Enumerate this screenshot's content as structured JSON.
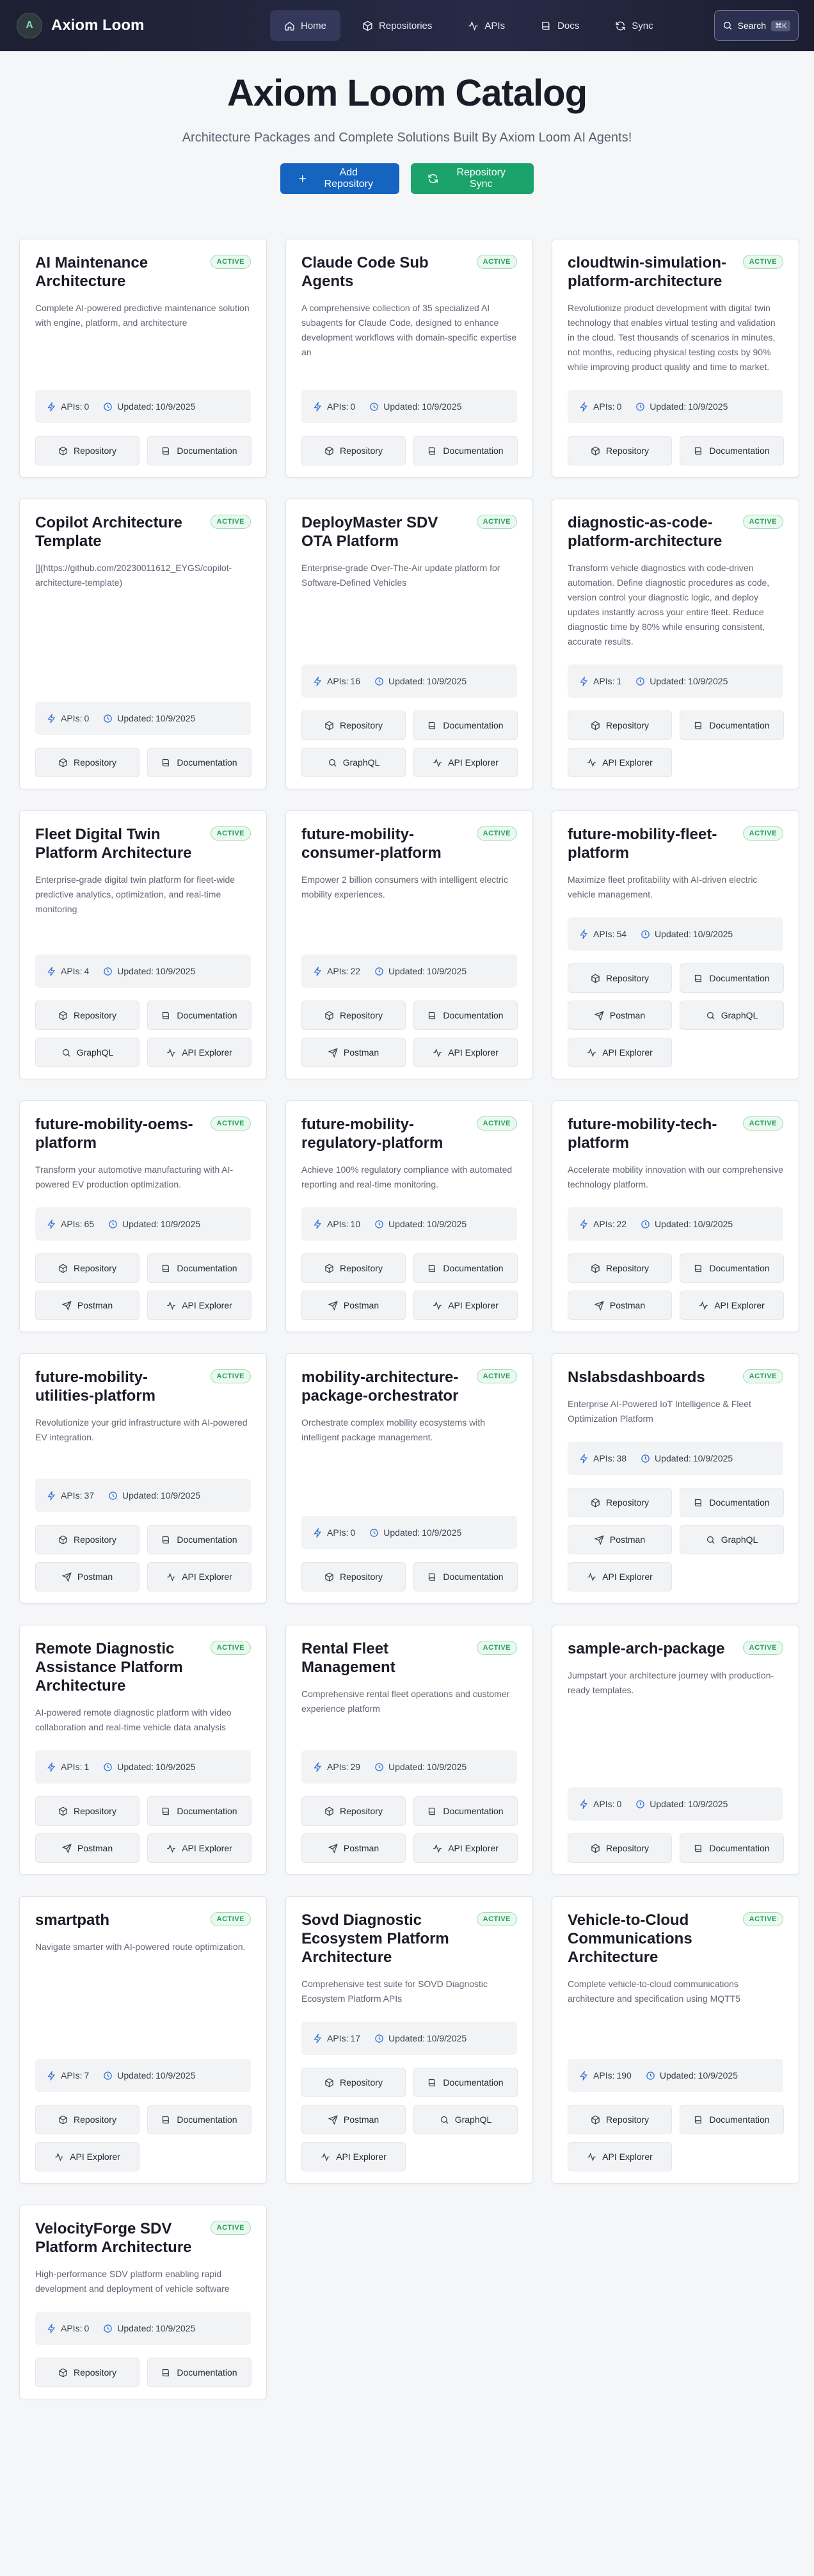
{
  "brand": {
    "title": "Axiom Loom",
    "logo_letter": "A"
  },
  "nav": {
    "links": [
      {
        "label": "Home",
        "icon": "home-icon"
      },
      {
        "label": "Repositories",
        "icon": "package-icon"
      },
      {
        "label": "APIs",
        "icon": "activity-icon"
      },
      {
        "label": "Docs",
        "icon": "book-icon"
      },
      {
        "label": "Sync",
        "icon": "sync-icon"
      }
    ],
    "search_label": "Search",
    "search_shortcut": "⌘K"
  },
  "hero": {
    "title": "Axiom Loom Catalog",
    "subtitle": "Architecture Packages and Complete Solutions Built By Axiom Loom AI Agents!",
    "add_label": "Add Repository",
    "sync_label": "Repository Sync"
  },
  "labels": {
    "apis_prefix": "APIs: ",
    "updated_prefix": "Updated: ",
    "actions": {
      "repository": "Repository",
      "documentation": "Documentation",
      "postman": "Postman",
      "graphql": "GraphQL",
      "api_explorer": "API Explorer"
    }
  },
  "colors": {
    "accent": "#1565c0",
    "sync": "#1aa36a",
    "active_badge": "#1f9e55",
    "nav_bg": "#1d1f33"
  },
  "cards": [
    {
      "title": "AI Maintenance Architecture",
      "status": "ACTIVE",
      "description": "Complete AI-powered predictive maintenance solution with engine, platform, and architecture",
      "apis": "0",
      "updated": "10/9/2025",
      "actions": [
        "repository",
        "documentation"
      ]
    },
    {
      "title": "Claude Code Sub Agents",
      "status": "ACTIVE",
      "description": "A comprehensive collection of 35 specialized AI subagents for Claude Code, designed to enhance development workflows with domain-specific expertise an",
      "apis": "0",
      "updated": "10/9/2025",
      "actions": [
        "repository",
        "documentation"
      ]
    },
    {
      "title": "cloudtwin-simulation-platform-architecture",
      "status": "ACTIVE",
      "description": "Revolutionize product development with digital twin technology that enables virtual testing and validation in the cloud. Test thousands of scenarios in minutes, not months, reducing physical testing costs by 90% while improving product quality and time to market.",
      "apis": "0",
      "updated": "10/9/2025",
      "actions": [
        "repository",
        "documentation"
      ]
    },
    {
      "title": "Copilot Architecture Template",
      "status": "ACTIVE",
      "description": "[](https://github.com/20230011612_EYGS/copilot-architecture-template)",
      "apis": "0",
      "updated": "10/9/2025",
      "actions": [
        "repository",
        "documentation"
      ]
    },
    {
      "title": "DeployMaster SDV OTA Platform",
      "status": "ACTIVE",
      "description": "Enterprise-grade Over-The-Air update platform for Software-Defined Vehicles",
      "apis": "16",
      "updated": "10/9/2025",
      "actions": [
        "repository",
        "documentation",
        "graphql",
        "api_explorer"
      ]
    },
    {
      "title": "diagnostic-as-code-platform-architecture",
      "status": "ACTIVE",
      "description": "Transform vehicle diagnostics with code-driven automation. Define diagnostic procedures as code, version control your diagnostic logic, and deploy updates instantly across your entire fleet. Reduce diagnostic time by 80% while ensuring consistent, accurate results.",
      "apis": "1",
      "updated": "10/9/2025",
      "actions": [
        "repository",
        "documentation",
        "api_explorer"
      ]
    },
    {
      "title": "Fleet Digital Twin Platform Architecture",
      "status": "ACTIVE",
      "description": "Enterprise-grade digital twin platform for fleet-wide predictive analytics, optimization, and real-time monitoring",
      "apis": "4",
      "updated": "10/9/2025",
      "actions": [
        "repository",
        "documentation",
        "graphql",
        "api_explorer"
      ]
    },
    {
      "title": "future-mobility-consumer-platform",
      "status": "ACTIVE",
      "description": "Empower 2 billion consumers with intelligent electric mobility experiences.",
      "apis": "22",
      "updated": "10/9/2025",
      "actions": [
        "repository",
        "documentation",
        "postman",
        "api_explorer"
      ]
    },
    {
      "title": "future-mobility-fleet-platform",
      "status": "ACTIVE",
      "description": "Maximize fleet profitability with AI-driven electric vehicle management.",
      "apis": "54",
      "updated": "10/9/2025",
      "actions": [
        "repository",
        "documentation",
        "postman",
        "graphql",
        "api_explorer"
      ]
    },
    {
      "title": "future-mobility-oems-platform",
      "status": "ACTIVE",
      "description": "Transform your automotive manufacturing with AI-powered EV production optimization.",
      "apis": "65",
      "updated": "10/9/2025",
      "actions": [
        "repository",
        "documentation",
        "postman",
        "api_explorer"
      ]
    },
    {
      "title": "future-mobility-regulatory-platform",
      "status": "ACTIVE",
      "description": "Achieve 100% regulatory compliance with automated reporting and real-time monitoring.",
      "apis": "10",
      "updated": "10/9/2025",
      "actions": [
        "repository",
        "documentation",
        "postman",
        "api_explorer"
      ]
    },
    {
      "title": "future-mobility-tech-platform",
      "status": "ACTIVE",
      "description": "Accelerate mobility innovation with our comprehensive technology platform.",
      "apis": "22",
      "updated": "10/9/2025",
      "actions": [
        "repository",
        "documentation",
        "postman",
        "api_explorer"
      ]
    },
    {
      "title": "future-mobility-utilities-platform",
      "status": "ACTIVE",
      "description": "Revolutionize your grid infrastructure with AI-powered EV integration.",
      "apis": "37",
      "updated": "10/9/2025",
      "actions": [
        "repository",
        "documentation",
        "postman",
        "api_explorer"
      ]
    },
    {
      "title": "mobility-architecture-package-orchestrator",
      "status": "ACTIVE",
      "description": "Orchestrate complex mobility ecosystems with intelligent package management.",
      "apis": "0",
      "updated": "10/9/2025",
      "actions": [
        "repository",
        "documentation"
      ]
    },
    {
      "title": "Nslabsdashboards",
      "status": "ACTIVE",
      "description": "Enterprise AI-Powered IoT Intelligence & Fleet Optimization Platform",
      "apis": "38",
      "updated": "10/9/2025",
      "actions": [
        "repository",
        "documentation",
        "postman",
        "graphql",
        "api_explorer"
      ]
    },
    {
      "title": "Remote Diagnostic Assistance Platform Architecture",
      "status": "ACTIVE",
      "description": "AI-powered remote diagnostic platform with video collaboration and real-time vehicle data analysis",
      "apis": "1",
      "updated": "10/9/2025",
      "actions": [
        "repository",
        "documentation",
        "postman",
        "api_explorer"
      ]
    },
    {
      "title": "Rental Fleet Management",
      "status": "ACTIVE",
      "description": "Comprehensive rental fleet operations and customer experience platform",
      "apis": "29",
      "updated": "10/9/2025",
      "actions": [
        "repository",
        "documentation",
        "postman",
        "api_explorer"
      ]
    },
    {
      "title": "sample-arch-package",
      "status": "ACTIVE",
      "description": "Jumpstart your architecture journey with production-ready templates.",
      "apis": "0",
      "updated": "10/9/2025",
      "actions": [
        "repository",
        "documentation"
      ]
    },
    {
      "title": "smartpath",
      "status": "ACTIVE",
      "description": "Navigate smarter with AI-powered route optimization.",
      "apis": "7",
      "updated": "10/9/2025",
      "actions": [
        "repository",
        "documentation",
        "api_explorer"
      ]
    },
    {
      "title": "Sovd Diagnostic Ecosystem Platform Architecture",
      "status": "ACTIVE",
      "description": "Comprehensive test suite for SOVD Diagnostic Ecosystem Platform APIs",
      "apis": "17",
      "updated": "10/9/2025",
      "actions": [
        "repository",
        "documentation",
        "postman",
        "graphql",
        "api_explorer"
      ]
    },
    {
      "title": "Vehicle-to-Cloud Communications Architecture",
      "status": "ACTIVE",
      "description": "Complete vehicle-to-cloud communications architecture and specification using MQTT5",
      "apis": "190",
      "updated": "10/9/2025",
      "actions": [
        "repository",
        "documentation",
        "api_explorer"
      ]
    },
    {
      "title": "VelocityForge SDV Platform Architecture",
      "status": "ACTIVE",
      "description": "High-performance SDV platform enabling rapid development and deployment of vehicle software",
      "apis": "0",
      "updated": "10/9/2025",
      "actions": [
        "repository",
        "documentation"
      ]
    }
  ]
}
